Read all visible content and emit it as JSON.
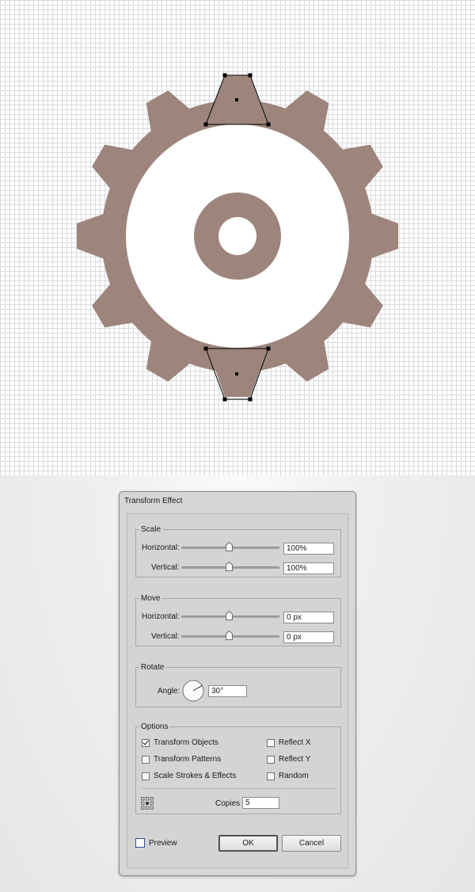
{
  "colors": {
    "gear_fill": "#9d857b",
    "canvas_grid": "#d9dadf",
    "selection": "#000000",
    "preview_accent": "#2b4f9a"
  },
  "dialog": {
    "title": "Transform Effect",
    "scale": {
      "legend": "Scale",
      "horizontal_label": "Horizontal:",
      "horizontal_value": "100%",
      "vertical_label": "Vertical:",
      "vertical_value": "100%"
    },
    "move": {
      "legend": "Move",
      "horizontal_label": "Horizontal:",
      "horizontal_value": "0 px",
      "vertical_label": "Vertical:",
      "vertical_value": "0 px"
    },
    "rotate": {
      "legend": "Rotate",
      "angle_label": "Angle:",
      "angle_value": "30°"
    },
    "options": {
      "legend": "Options",
      "transform_objects": {
        "label": "Transform Objects",
        "checked": true
      },
      "transform_patterns": {
        "label": "Transform Patterns",
        "checked": false
      },
      "scale_strokes": {
        "label": "Scale Strokes & Effects",
        "checked": false
      },
      "reflect_x": {
        "label": "Reflect X",
        "checked": false
      },
      "reflect_y": {
        "label": "Reflect Y",
        "checked": false
      },
      "random": {
        "label": "Random",
        "checked": false
      },
      "copies_label": "Copies",
      "copies_value": "5"
    },
    "preview": {
      "label": "Preview",
      "checked": false
    },
    "ok_label": "OK",
    "cancel_label": "Cancel"
  }
}
